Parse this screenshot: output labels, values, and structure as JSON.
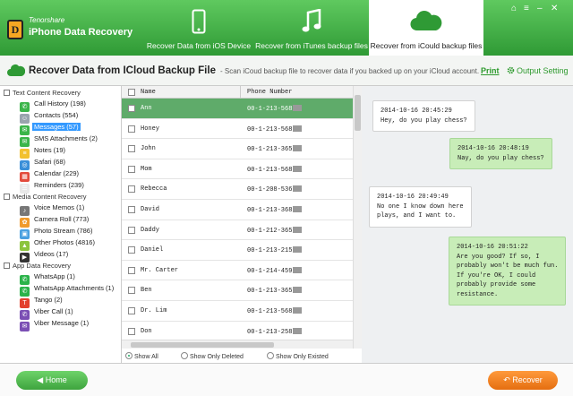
{
  "app": {
    "brand_top": "Tenorshare",
    "brand_name": "iPhone Data Recovery",
    "logo_letter": "D"
  },
  "tabs": [
    {
      "label": "Recover Data from iOS Device"
    },
    {
      "label": "Recover from iTunes backup files"
    },
    {
      "label": "Recover from iCould backup files"
    }
  ],
  "header": {
    "title": "Recover Data from ICloud Backup File",
    "description": "- Scan iCoud backup file to recover data if you backed up on your iCloud account.",
    "print": "Print",
    "output_setting": "Output Setting"
  },
  "sidebar": {
    "groups": [
      {
        "label": "Text Content Recovery",
        "items": [
          {
            "label": "Call History (198)",
            "color": "#3bb54a",
            "glyph": "✆"
          },
          {
            "label": "Contacts (554)",
            "color": "#9aa4ae",
            "glyph": "☺"
          },
          {
            "label": "Messages (57)",
            "color": "#3bb54a",
            "glyph": "✉",
            "selected": true
          },
          {
            "label": "SMS Attachments (2)",
            "color": "#3bb54a",
            "glyph": "✉"
          },
          {
            "label": "Notes (19)",
            "color": "#f2c12e",
            "glyph": "≡"
          },
          {
            "label": "Safari (68)",
            "color": "#3a8fd9",
            "glyph": "◎"
          },
          {
            "label": "Calendar (229)",
            "color": "#e34b3c",
            "glyph": "▦"
          },
          {
            "label": "Reminders (239)",
            "color": "#e8e8e8",
            "glyph": "☰"
          }
        ]
      },
      {
        "label": "Media Content Recovery",
        "items": [
          {
            "label": "Voice Memos (1)",
            "color": "#777777",
            "glyph": "♪"
          },
          {
            "label": "Camera Roll (773)",
            "color": "#f09a2b",
            "glyph": "✿"
          },
          {
            "label": "Photo Stream (786)",
            "color": "#4aa0e0",
            "glyph": "▣"
          },
          {
            "label": "Other Photos (4816)",
            "color": "#8cc43e",
            "glyph": "▲"
          },
          {
            "label": "Videos (17)",
            "color": "#333333",
            "glyph": "▶"
          }
        ]
      },
      {
        "label": "App Data Recovery",
        "items": [
          {
            "label": "WhatsApp (1)",
            "color": "#2bb34a",
            "glyph": "✆"
          },
          {
            "label": "WhatsApp Attachments (1)",
            "color": "#2bb34a",
            "glyph": "✆"
          },
          {
            "label": "Tango (2)",
            "color": "#e3402c",
            "glyph": "T"
          },
          {
            "label": "Viber Call (1)",
            "color": "#7b4fb4",
            "glyph": "✆"
          },
          {
            "label": "Viber Message (1)",
            "color": "#7b4fb4",
            "glyph": "✉"
          }
        ]
      }
    ]
  },
  "table": {
    "columns": [
      "Name",
      "Phone Number"
    ],
    "rows": [
      {
        "name": "Ann",
        "phone": "00-1-213-568",
        "selected": true
      },
      {
        "name": "Honey",
        "phone": "00-1-213-568"
      },
      {
        "name": "John",
        "phone": "00-1-213-365"
      },
      {
        "name": "Mom",
        "phone": "00-1-213-568"
      },
      {
        "name": "Rebecca",
        "phone": "00-1-208-536"
      },
      {
        "name": "David",
        "phone": "00-1-213-368"
      },
      {
        "name": "Daddy",
        "phone": "00-1-212-365"
      },
      {
        "name": "Daniel",
        "phone": "00-1-213-215"
      },
      {
        "name": "Mr. Carter",
        "phone": "00-1-214-459"
      },
      {
        "name": "Ben",
        "phone": "00-1-213-365"
      },
      {
        "name": "Dr. Lim",
        "phone": "00-1-213-568"
      },
      {
        "name": "Don",
        "phone": "00-1-213-258"
      }
    ]
  },
  "filters": {
    "show_all": "Show All",
    "show_deleted": "Show Only Deleted",
    "show_existed": "Show Only Existed"
  },
  "chat": [
    {
      "dir": "in",
      "text": "2014-10-16 20:45:29\nHey, do you play chess?"
    },
    {
      "dir": "out",
      "text": "2014-10-16 20:48:19\nNay, do you play chess?"
    },
    {
      "dir": "in",
      "text": "2014-10-16 20:49:49\nNo one I know down here\nplays, and I want to."
    },
    {
      "dir": "out",
      "text": "2014-10-16 20:51:22\nAre you good? If so, I\nprobably won't be much fun.\nIf you're OK, I could\nprobably provide some\nresistance."
    }
  ],
  "footer": {
    "home": "Home",
    "recover": "Recover"
  },
  "colors": {
    "brand_green": "#2f9a35",
    "selected_row": "#5fab6a",
    "recover_orange": "#e56e10"
  }
}
